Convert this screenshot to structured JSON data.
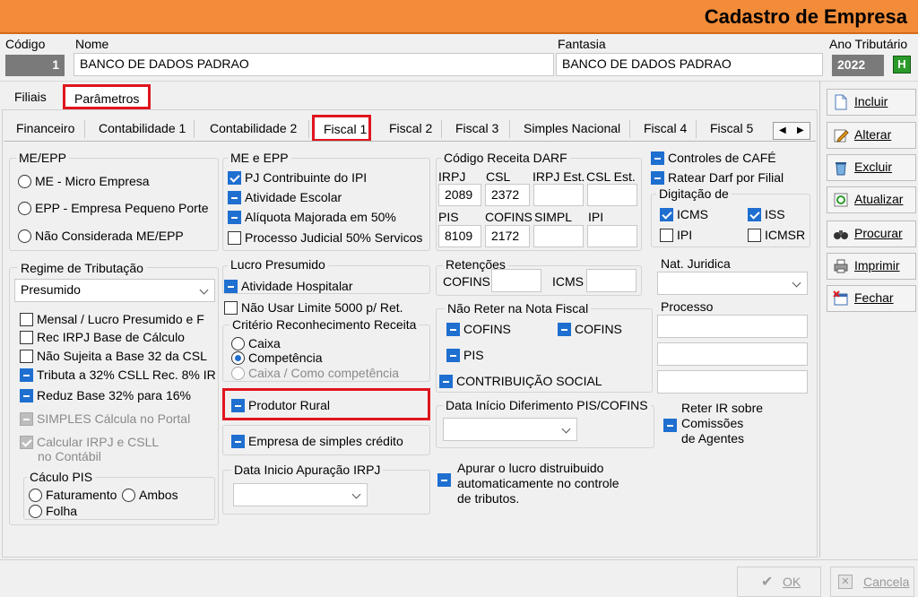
{
  "title": "Cadastro de Empresa",
  "header": {
    "codigo_label": "Código",
    "codigo_value": "1",
    "nome_label": "Nome",
    "nome_value": "BANCO DE DADOS PADRAO",
    "fantasia_label": "Fantasia",
    "fantasia_value": "BANCO DE DADOS PADRAO",
    "ano_label": "Ano Tributário",
    "ano_value": "2022",
    "ano_button": "H"
  },
  "main_tabs": [
    "Filiais",
    "Parâmetros"
  ],
  "sub_tabs": [
    "Financeiro",
    "Contabilidade 1",
    "Contabilidade 2",
    "Fiscal 1",
    "Fiscal 2",
    "Fiscal 3",
    "Simples Nacional",
    "Fiscal 4",
    "Fiscal 5"
  ],
  "me_epp": {
    "label": "ME/EPP",
    "options": [
      "ME - Micro Empresa",
      "EPP - Empresa Pequeno Porte",
      "Não Considerada ME/EPP"
    ]
  },
  "me_e_epp": {
    "label": "ME e EPP",
    "items": [
      "PJ Contribuinte do IPI",
      "Atividade Escolar",
      "Alíquota Majorada em 50%",
      "Processo Judicial 50% Servicos"
    ]
  },
  "darf": {
    "label": "Código Receita DARF",
    "col1": [
      "IRPJ",
      "CSL",
      "IRPJ Est.",
      "CSL Est."
    ],
    "val1": [
      "2089",
      "2372",
      "",
      ""
    ],
    "col2": [
      "PIS",
      "COFINS",
      "SIMPL",
      "IPI"
    ],
    "val2": [
      "8109",
      "2172",
      "",
      ""
    ]
  },
  "cafe": {
    "controles": "Controles de CAFÉ",
    "ratear": "Ratear Darf por Filial",
    "digitacao_label": "Digitação de",
    "icms": "ICMS",
    "iss": "ISS",
    "ipi": "IPI",
    "icmsr": "ICMSR"
  },
  "regime": {
    "label": "Regime de Tributação",
    "selected": "Presumido",
    "items": [
      "Mensal / Lucro Presumido e F",
      "Rec IRPJ Base de Cálculo",
      "Não Sujeita a Base 32 da CSL",
      "Tributa a 32% CSLL Rec. 8% IR",
      "Reduz Base 32% para 16%",
      "SIMPLES Cálcula  no Portal",
      "Calcular IRPJ e CSLL",
      "no Contábil"
    ]
  },
  "pis": {
    "label": "Cáculo PIS",
    "faturamento": "Faturamento",
    "ambos": "Ambos",
    "folha": "Folha"
  },
  "lucro": {
    "label": "Lucro Presumido",
    "atividade": "Atividade Hospitalar",
    "nao_usar": "Não Usar Limite 5000 p/ Ret.",
    "criterio": "Critério Reconhecimento  Receita",
    "caixa": "Caixa",
    "competencia": "Competência",
    "caixa_comp": "Caixa / Como competência",
    "produtor": "Produtor Rural",
    "empresa_simples": "Empresa de simples crédito",
    "data_apuracao": "Data Inicio Apuração IRPJ"
  },
  "retencoes": {
    "label": "Retenções",
    "cofins": "COFINS",
    "icms": "ICMS",
    "nao_reter": "Não Reter na Nota Fiscal",
    "cofins1": "COFINS",
    "cofins2": "COFINS",
    "pis": "PIS",
    "contrib": "CONTRIBUIÇÃO SOCIAL",
    "data_diferimento": "Data Início Diferimento PIS/COFINS",
    "apurar": [
      "Apurar o lucro distruibuido",
      "automaticamente no controle",
      "de tributos."
    ]
  },
  "nat": {
    "label": "Nat. Juridica",
    "processo": "Processo",
    "reter": [
      "Reter IR sobre",
      "Comissões",
      "de Agentes"
    ]
  },
  "side_buttons": [
    "Incluir",
    "Alterar",
    "Excluir",
    "Atualizar",
    "Procurar",
    "Imprimir",
    "Fechar"
  ],
  "footer": {
    "ok": "OK",
    "cancela": "Cancela"
  }
}
